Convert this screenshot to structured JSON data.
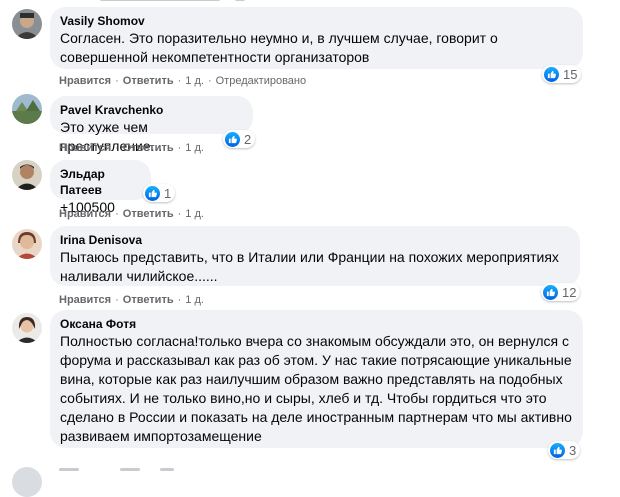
{
  "colors": {
    "bubble_bg": "#f0f2f5",
    "meta_text": "#65676b",
    "like_blue": "#1877f2"
  },
  "icons": {
    "reaction": "like-icon"
  },
  "actions": {
    "like": "Нравится",
    "reply": "Ответить"
  },
  "comments": [
    {
      "author": "Vasily Shomov",
      "text": "Согласен. Это поразительно неумно и, в лучшем случае, говорит о совершенной некомпетентности организаторов",
      "time": "1 д.",
      "edited": "Отредактировано",
      "reactions": "15"
    },
    {
      "author": "Pavel Kravchenko",
      "text": "Это хуже чем преступление...",
      "time": "1 д.",
      "reactions": "2"
    },
    {
      "author": "Эльдар Патеев",
      "text": "+100500",
      "time": "1 д.",
      "reactions": "1"
    },
    {
      "author": "Irina Denisova",
      "text": "Пытаюсь представить, что в Италии или Франции на похожих мероприятиях наливали чилийское......",
      "time": "1 д.",
      "reactions": "12"
    },
    {
      "author": "Оксана Фотя",
      "text": "Полностью согласна!только вчера со знакомым обсуждали это, он вернулся с форума и рассказывал как раз об этом. У нас такие потрясающие уникальные вина, которые как раз наилучшим образом важно представлять на подобных событиях. И не только вино,но и сыры, хлеб и тд. Чтобы гордиться что это сделано в России и показать на деле иностранным партнерам что мы активно развиваем импортозамещение",
      "time": "1 д.",
      "reactions": "3"
    }
  ]
}
